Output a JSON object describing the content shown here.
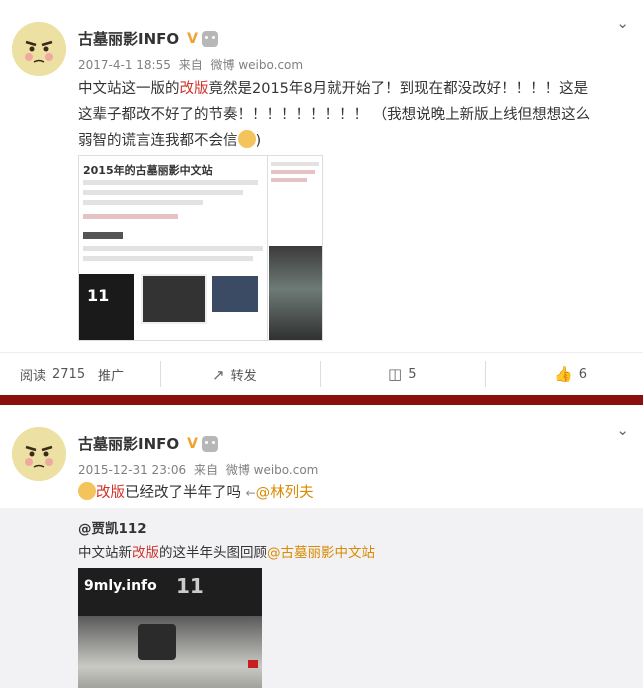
{
  "posts": [
    {
      "author": "古墓丽影INFO",
      "verified_badge": "V",
      "timestamp": "2017-4-1 18:55",
      "source_prefix": "来自",
      "source": "微博 weibo.com",
      "text_segments": {
        "s1": "中文站这一版的",
        "s2": "改版",
        "s3": "竟然是2015年8月就开始了！到现在都没改好！！！！这是",
        "s4": "这辈子都改不好了的节奏！！！！！！！！！ （我想说晚上新版上线但想想这么",
        "s5": "弱智的谎言连我都不会信",
        "s6": ")"
      },
      "image_caption": "2015年的古墓丽影中文站",
      "stats": {
        "reads_label": "阅读",
        "reads_value": "2715",
        "promote": "推广",
        "share": "转发",
        "comments": "5",
        "likes": "6"
      }
    },
    {
      "author": "古墓丽影INFO",
      "verified_badge": "V",
      "timestamp": "2015-12-31 23:06",
      "source_prefix": "来自",
      "source": "微博 weibo.com",
      "text_segments": {
        "s1": "改版",
        "s2": "已经改了半年了吗",
        "s3": "@林列夫"
      },
      "repost": {
        "user": "@贾凯112",
        "text_a": "中文站新",
        "text_b": "改版",
        "text_c": "的这半年头图回顾",
        "link": "@古墓丽影中文站"
      },
      "repost_image_text": "9mly.info"
    }
  ],
  "colors": {
    "accent_red": "#d0342c",
    "link_orange": "#d88a00",
    "divider": "#8a1010",
    "verified": "#f2a02e"
  },
  "icons": [
    "chevron-down-icon",
    "share-icon",
    "comment-icon",
    "like-icon",
    "robot-badge-icon"
  ]
}
